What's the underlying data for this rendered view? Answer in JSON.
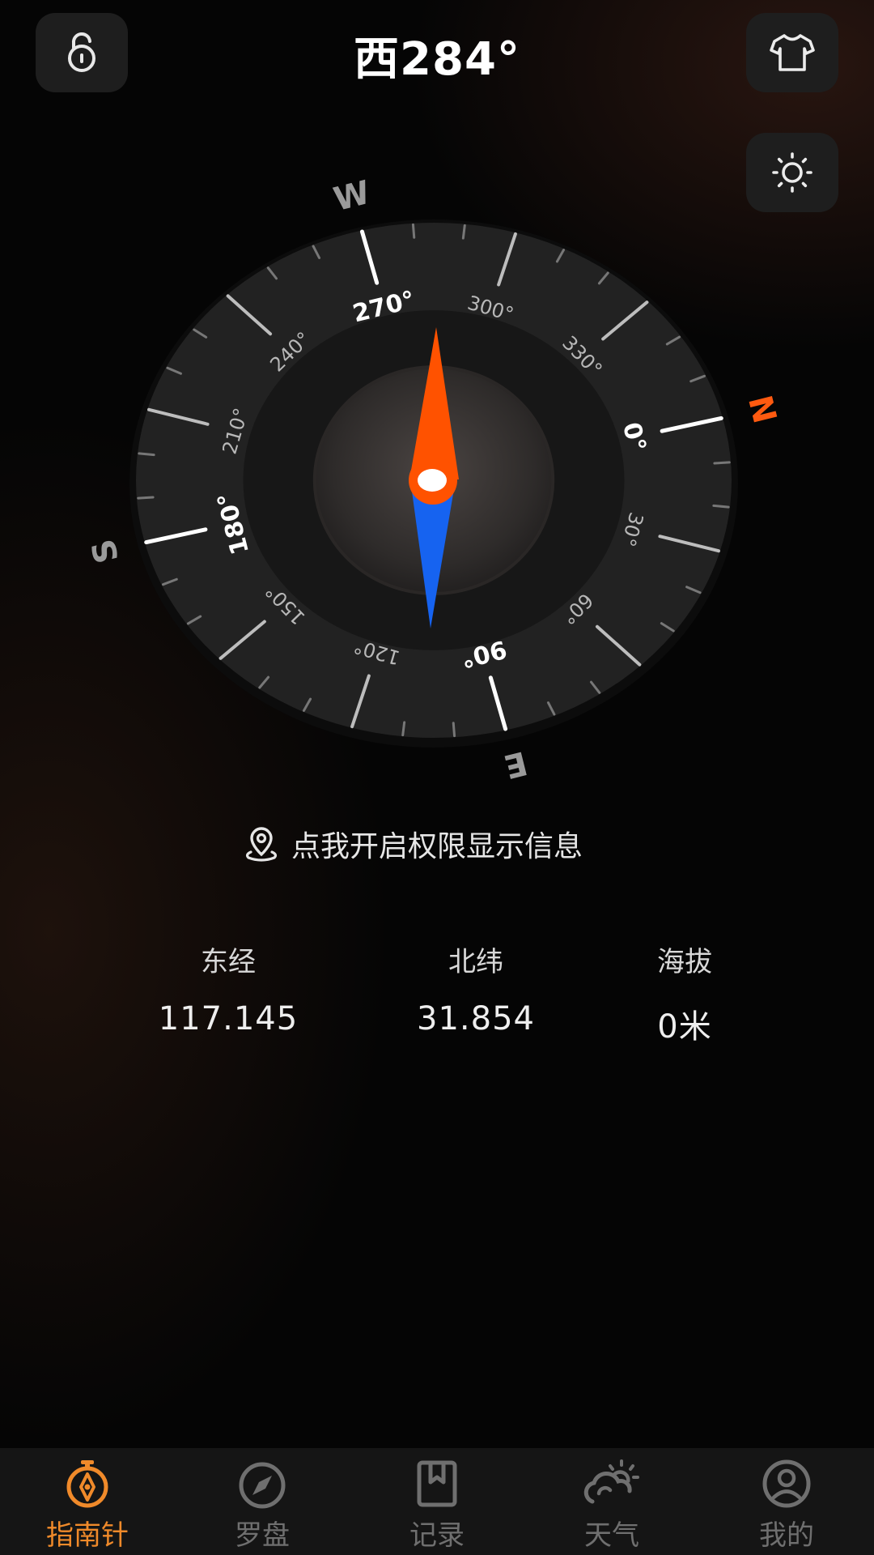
{
  "header": {
    "heading": "西284°"
  },
  "compass": {
    "heading_degrees": 284,
    "cardinals": {
      "north": "N",
      "east": "E",
      "south": "S",
      "west": "W"
    },
    "degree_labels": [
      "0°",
      "30°",
      "60°",
      "90°",
      "120°",
      "150°",
      "180°",
      "210°",
      "240°",
      "270°",
      "300°",
      "330°"
    ],
    "colors": {
      "needle_north": "#ff5200",
      "needle_south": "#1663f0",
      "north_marker": "#ff5a10"
    }
  },
  "permission": {
    "text": "点我开启权限显示信息"
  },
  "info": {
    "longitude": {
      "label": "东经",
      "value": "117.145"
    },
    "latitude": {
      "label": "北纬",
      "value": "31.854"
    },
    "altitude": {
      "label": "海拔",
      "value": "0米"
    }
  },
  "tabs": [
    {
      "label": "指南针",
      "icon": "compass-pointer-icon",
      "active": true
    },
    {
      "label": "罗盘",
      "icon": "compass-icon",
      "active": false
    },
    {
      "label": "记录",
      "icon": "bookmark-icon",
      "active": false
    },
    {
      "label": "天气",
      "icon": "weather-icon",
      "active": false
    },
    {
      "label": "我的",
      "icon": "user-icon",
      "active": false
    }
  ],
  "theme": {
    "accent": "#f08a2a",
    "inactive": "#6f6f6f"
  }
}
